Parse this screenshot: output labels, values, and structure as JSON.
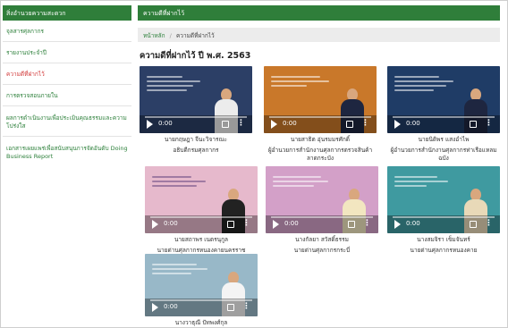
{
  "sidebar": {
    "title": "สิ่งอำนวยความสะดวก",
    "items": [
      {
        "label": "จุลสารศุลกากร",
        "active": false
      },
      {
        "label": "รายงานประจำปี",
        "active": false
      },
      {
        "label": "ความดีที่ฝากไว้",
        "active": true
      },
      {
        "label": "การตรวจสอบภายใน",
        "active": false
      },
      {
        "label": "ผลการดำเนินงานเพื่อประเมินคุณธรรมและความโปร่งใส",
        "active": false
      },
      {
        "label": "เอกสารเผยแพร่เพื่อสนับสนุนการจัดอันดับ Doing Business Report",
        "active": false
      }
    ]
  },
  "main": {
    "header": "ความดีที่ฝากไว้",
    "breadcrumb": {
      "home": "หน้าหลัก",
      "sep": "/",
      "current": "ความดีที่ฝากไว้"
    },
    "section_title": "ความดีที่ฝากไว้ ปี พ.ศ. 2563",
    "videos": [
      {
        "time": "0:00",
        "caption_1": "นายกฤษฎา จีนะวิจารณะ",
        "caption_2": "อธิบดีกรมศุลกากร",
        "bg": "#2c3f66"
      },
      {
        "time": "0:00",
        "caption_1": "นายสาธิต อุ่นรมมรศักดิ์",
        "caption_2": "ผู้อำนวยการสำนักงานศุลกากรตรวจสินค้าลาดกระบัง",
        "bg": "#c9782a"
      },
      {
        "time": "0:00",
        "caption_1": "นายนิติพร แสงอำไพ",
        "caption_2": "ผู้อำนวยการสำนักงานศุลกากรท่าเรือแหลมฉบัง",
        "bg": "#1f3c66"
      },
      {
        "time": "0:00",
        "caption_1": "นายสถาพร เนตรนุกูล",
        "caption_2": "นายด่านศุลกากรหนองคายนครราช",
        "bg": "#e6b9cc"
      },
      {
        "time": "0:00",
        "caption_1": "นางกัลยา สวัสดิ์ธรรม",
        "caption_2": "นายด่านศุลกากรกระบี่",
        "bg": "#d3a0c8"
      },
      {
        "time": "0:00",
        "caption_1": "นางสมจิรา เข็มจันทร์",
        "caption_2": "นายด่านศุลกากรหนองคาย",
        "bg": "#3f9aa0"
      },
      {
        "time": "0:00",
        "caption_1": "นางวาธุณี ปัทพงศ์กุล",
        "caption_2": "",
        "bg": "#98b8c8"
      }
    ]
  },
  "icons": [
    "play-icon",
    "volume-icon",
    "more-options-icon"
  ],
  "colors": {
    "brand_green": "#2f7e3a",
    "active_red": "#d23a3a",
    "breadcrumb_bg": "#ececec"
  }
}
